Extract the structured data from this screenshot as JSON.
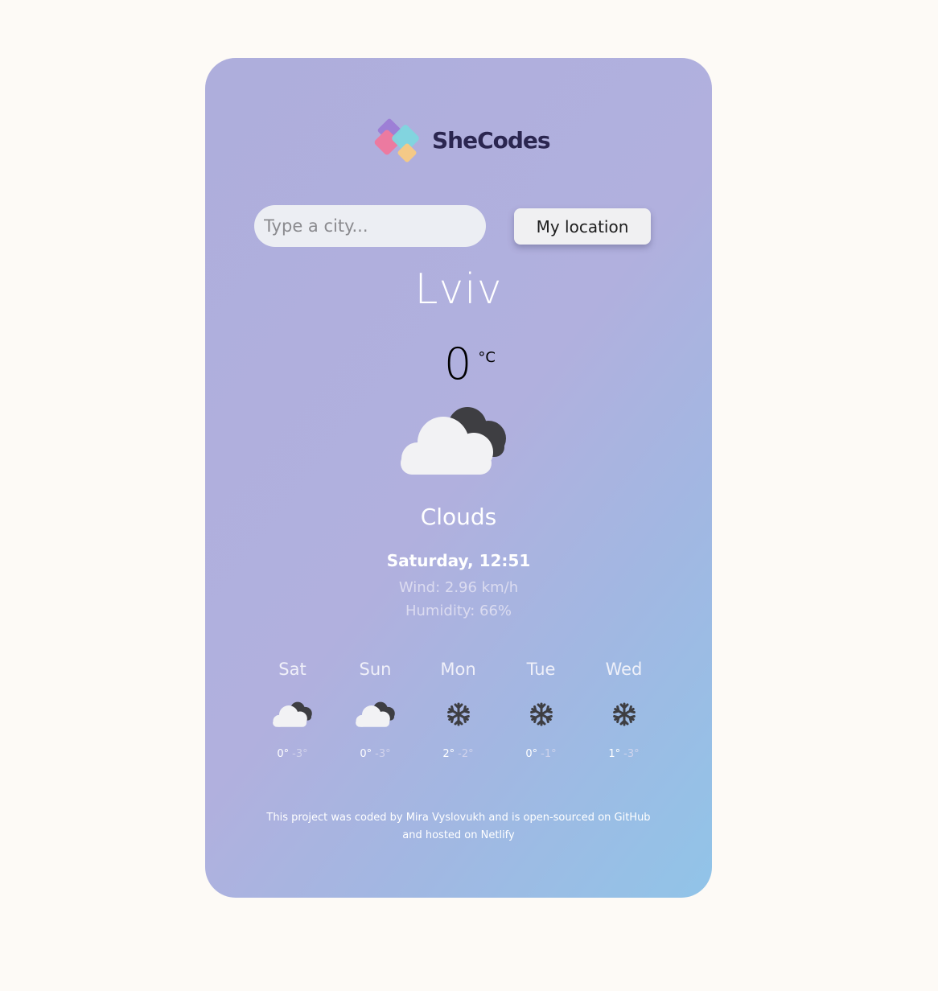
{
  "brand": {
    "name": "SheCodes"
  },
  "search": {
    "placeholder": "Type a city..."
  },
  "location_button": {
    "label": "My location"
  },
  "current": {
    "city": "Lviv",
    "temperature": "0",
    "unit": "°C",
    "icon": "cloudy-icon",
    "description": "Clouds",
    "datetime": "Saturday, 12:51",
    "wind": "Wind: 2.96 km/h",
    "humidity": "Humidity: 66%"
  },
  "forecast": [
    {
      "day": "Sat",
      "icon": "cloudy-icon",
      "max": "0°",
      "min": "-3°"
    },
    {
      "day": "Sun",
      "icon": "cloudy-icon",
      "max": "0°",
      "min": "-3°"
    },
    {
      "day": "Mon",
      "icon": "snowflake-icon",
      "max": "2°",
      "min": "-2°"
    },
    {
      "day": "Tue",
      "icon": "snowflake-icon",
      "max": "0°",
      "min": "-1°"
    },
    {
      "day": "Wed",
      "icon": "snowflake-icon",
      "max": "1°",
      "min": "-3°"
    }
  ],
  "footer": {
    "text1": "This project was coded by ",
    "author": "Mira Vyslovukh",
    "text2": " and is ",
    "github": "open-sourced on GitHub",
    "text3": "and hosted on ",
    "netlify": "Netlify"
  },
  "colors": {
    "background": "#fdfaf6",
    "card_gradient_start": "#aeaedc",
    "card_gradient_end": "#91c4e8",
    "logo_text": "#2b2650"
  }
}
